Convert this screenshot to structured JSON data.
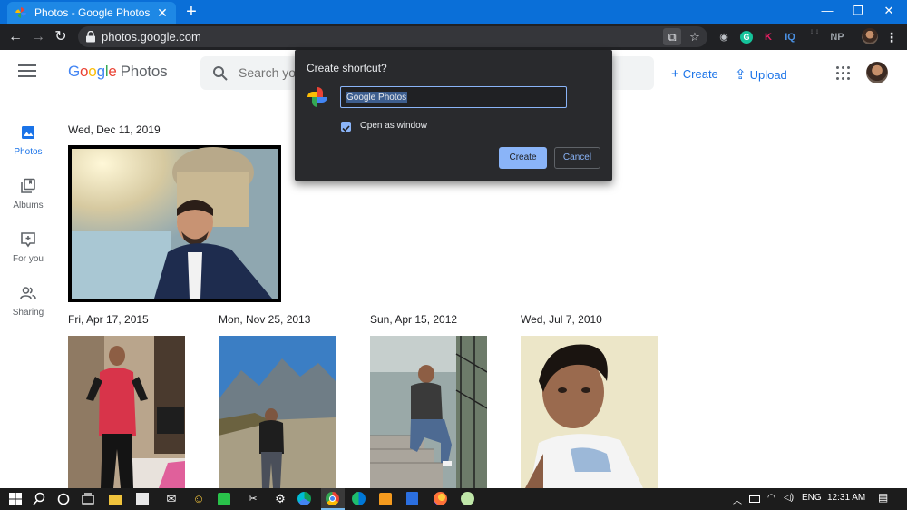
{
  "browser": {
    "tab_title": "Photos - Google Photos",
    "tab_close": "✕",
    "new_tab": "+",
    "url": "photos.google.com",
    "window_controls": [
      "—",
      "❐",
      "✕"
    ],
    "extensions": [
      "G",
      "K",
      "IQ",
      "NP"
    ]
  },
  "header": {
    "logo_letters": [
      "G",
      "o",
      "o",
      "g",
      "l",
      "e"
    ],
    "logo_product": "Photos",
    "search_placeholder": "Search your photos",
    "create_label": "Create",
    "upload_label": "Upload"
  },
  "sidebar": {
    "items": [
      {
        "label": "Photos",
        "active": true
      },
      {
        "label": "Albums",
        "active": false
      },
      {
        "label": "For you",
        "active": false
      },
      {
        "label": "Sharing",
        "active": false
      }
    ]
  },
  "groups": [
    {
      "date": "Wed, Dec 11, 2019"
    },
    {
      "date": "Fri, Apr 17, 2015"
    },
    {
      "date": "Mon, Nov 25, 2013"
    },
    {
      "date": "Sun, Apr 15, 2012"
    },
    {
      "date": "Wed, Jul 7, 2010"
    }
  ],
  "dialog": {
    "title": "Create shortcut?",
    "name_value": "Google Photos",
    "checkbox_label": "Open as window",
    "checkbox_checked": true,
    "create_label": "Create",
    "cancel_label": "Cancel"
  },
  "taskbar": {
    "language": "ENG",
    "time": "12:31 AM"
  },
  "colors": {
    "accent": "#1a73e8",
    "titlebar": "#0a6fd8",
    "dialog_bg": "#292a2d",
    "dialog_button": "#8ab4f8"
  }
}
